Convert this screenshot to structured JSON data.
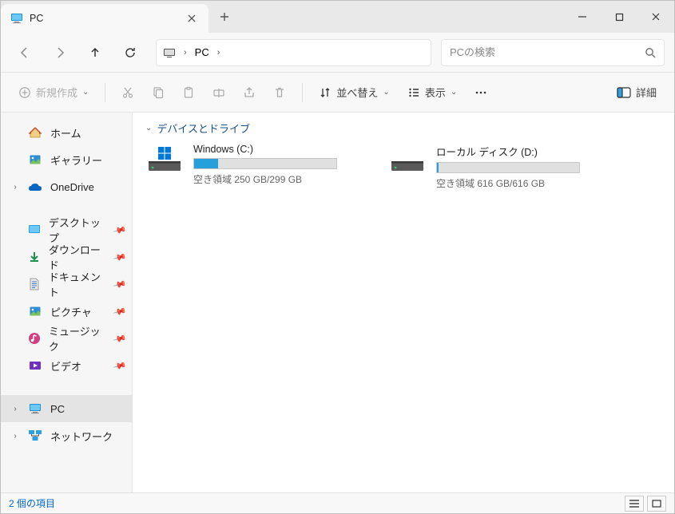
{
  "window": {
    "tab_title": "PC",
    "min": "—",
    "max": "☐",
    "close": "✕"
  },
  "nav": {
    "breadcrumb_root": "PC",
    "search_placeholder": "PCの検索"
  },
  "toolbar": {
    "new_label": "新規作成",
    "sort_label": "並べ替え",
    "view_label": "表示",
    "details_label": "詳細"
  },
  "sidebar": {
    "home": "ホーム",
    "gallery": "ギャラリー",
    "onedrive": "OneDrive",
    "desktop": "デスクトップ",
    "downloads": "ダウンロード",
    "documents": "ドキュメント",
    "pictures": "ピクチャ",
    "music": "ミュージック",
    "videos": "ビデオ",
    "pc": "PC",
    "network": "ネットワーク"
  },
  "group_header": "デバイスとドライブ",
  "drives": [
    {
      "name": "Windows (C:)",
      "space_text": "空き領域 250 GB/299 GB",
      "fill_percent": 17,
      "fill_color": "#26a0da",
      "type": "windows"
    },
    {
      "name": "ローカル ディスク (D:)",
      "space_text": "空き領域 616 GB/616 GB",
      "fill_percent": 1,
      "fill_color": "#26a0da",
      "type": "disk"
    }
  ],
  "status": {
    "item_count": "2 個の項目"
  }
}
